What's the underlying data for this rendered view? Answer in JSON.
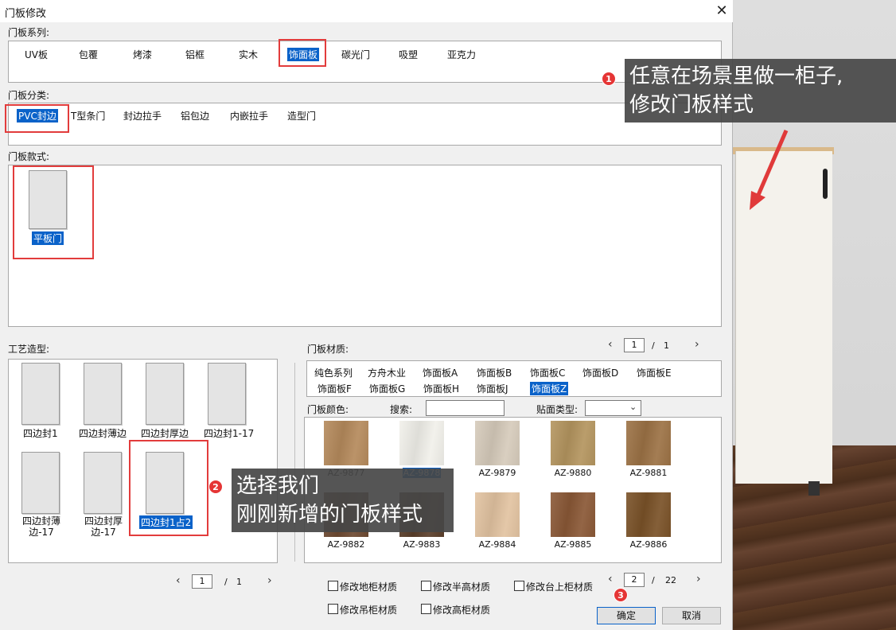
{
  "window": {
    "title": "门板修改",
    "close_glyph": "✕"
  },
  "series": {
    "label": "门板系列:",
    "tabs": [
      "UV板",
      "包覆",
      "烤漆",
      "铝框",
      "实木",
      "饰面板",
      "碳光门",
      "吸塑",
      "亚克力"
    ],
    "selected": "饰面板"
  },
  "category": {
    "label": "门板分类:",
    "tabs": [
      "PVC封边",
      "T型条门",
      "封边拉手",
      "铝包边",
      "内嵌拉手",
      "造型门"
    ],
    "selected": "PVC封边"
  },
  "style": {
    "label": "门板款式:",
    "items": [
      "平板门"
    ],
    "selected": "平板门"
  },
  "craft": {
    "label": "工艺造型:",
    "items": [
      "四边封1",
      "四边封薄边",
      "四边封厚边",
      "四边封1-17",
      "四边封薄边-17",
      "四边封厚边-17",
      "四边封1占2"
    ],
    "selected": "四边封1占2",
    "pager": {
      "current": "1",
      "separator": "/",
      "total": "1"
    }
  },
  "material": {
    "label": "门板材质:",
    "pager": {
      "current": "1",
      "separator": "/",
      "total": "1"
    },
    "tabs_row1": [
      "纯色系列",
      "方舟木业",
      "饰面板A",
      "饰面板B",
      "饰面板C",
      "饰面板D",
      "饰面板E"
    ],
    "tabs_row2": [
      "饰面板F",
      "饰面板G",
      "饰面板H",
      "饰面板J",
      "饰面板Z"
    ],
    "selected": "饰面板Z",
    "color_label": "门板颜色:",
    "search_label": "搜索:",
    "search_value": "",
    "type_label": "贴面类型:",
    "type_value": "",
    "swatches": [
      {
        "code": "AZ-9877",
        "color": "#b58a5c"
      },
      {
        "code": "AZ-9878",
        "color": "#f1f0ea"
      },
      {
        "code": "AZ-9879",
        "color": "#d6cbbb"
      },
      {
        "code": "AZ-9880",
        "color": "#b4955f"
      },
      {
        "code": "AZ-9881",
        "color": "#9c7245"
      },
      {
        "code": "AZ-9882",
        "color": "#6e4a32"
      },
      {
        "code": "AZ-9883",
        "color": "#5b3f2b"
      },
      {
        "code": "AZ-9884",
        "color": "#e2c3a1"
      },
      {
        "code": "AZ-9885",
        "color": "#8a5836"
      },
      {
        "code": "AZ-9886",
        "color": "#7a5228"
      }
    ],
    "selected_swatch": "AZ-9878",
    "swatch_pager": {
      "current": "2",
      "separator": "/",
      "total": "22"
    }
  },
  "options": [
    "修改地柜材质",
    "修改半高材质",
    "修改台上柜材质",
    "修改吊柜材质",
    "修改高柜材质"
  ],
  "buttons": {
    "ok": "确定",
    "cancel": "取消"
  },
  "callouts": [
    {
      "badge": "1",
      "line1": "任意在场景里做一柜子,",
      "line2": "修改门板样式"
    },
    {
      "badge": "2",
      "line1": "选择我们",
      "line2": "刚刚新增的门板样式"
    },
    {
      "badge": "3"
    }
  ],
  "colors": {
    "selection": "#0a62c9",
    "highlight_box": "#e23c3c",
    "badge": "#e53535"
  }
}
